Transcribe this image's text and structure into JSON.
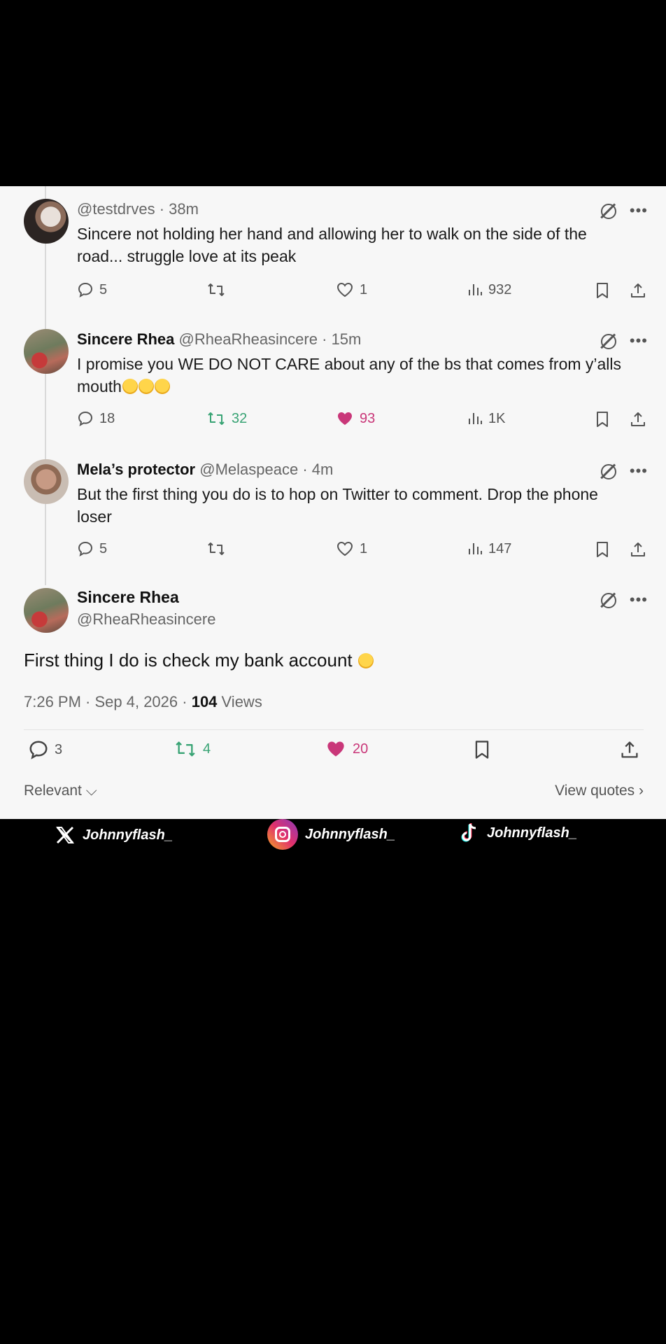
{
  "replies": [
    {
      "name": "",
      "handle": "@testdrves",
      "time": "38m",
      "text": "Sincere not holding her hand and allowing her to walk on the side of the road... struggle love at its peak",
      "replies": "5",
      "reposts": "",
      "likes": "1",
      "views": "932"
    },
    {
      "name": "Sincere Rhea",
      "handle": "@RheaRheasincere",
      "time": "15m",
      "text": "I promise you WE DO NOT CARE about any of the bs that comes from y’alls mouth",
      "emoji_count": 3,
      "replies": "18",
      "reposts": "32",
      "likes": "93",
      "views": "1K"
    },
    {
      "name": "Mela’s protector",
      "handle": "@Melaspeace",
      "time": "4m",
      "text": "But the first thing you do is to hop on Twitter to comment. Drop the phone loser",
      "replies": "5",
      "reposts": "",
      "likes": "1",
      "views": "147"
    }
  ],
  "main_post": {
    "name": "Sincere Rhea",
    "handle": "@RheaRheasincere",
    "text": "First thing I do is check my bank account",
    "timestamp": "7:26 PM · Sep 4, 2026 · ",
    "views_count": "104",
    "views_label": " Views",
    "replies": "3",
    "reposts": "4",
    "likes": "20"
  },
  "footer": {
    "sort_label": "Relevant",
    "quotes_label": "View quotes"
  },
  "social": {
    "x_handle": "Johnnyflash_",
    "ig_handle": "Johnnyflash_",
    "tiktok_handle": "Johnnyflash_"
  },
  "colors": {
    "repost_active": "#38a374",
    "like_active": "#c93779",
    "card_bg": "#f7f7f7"
  }
}
